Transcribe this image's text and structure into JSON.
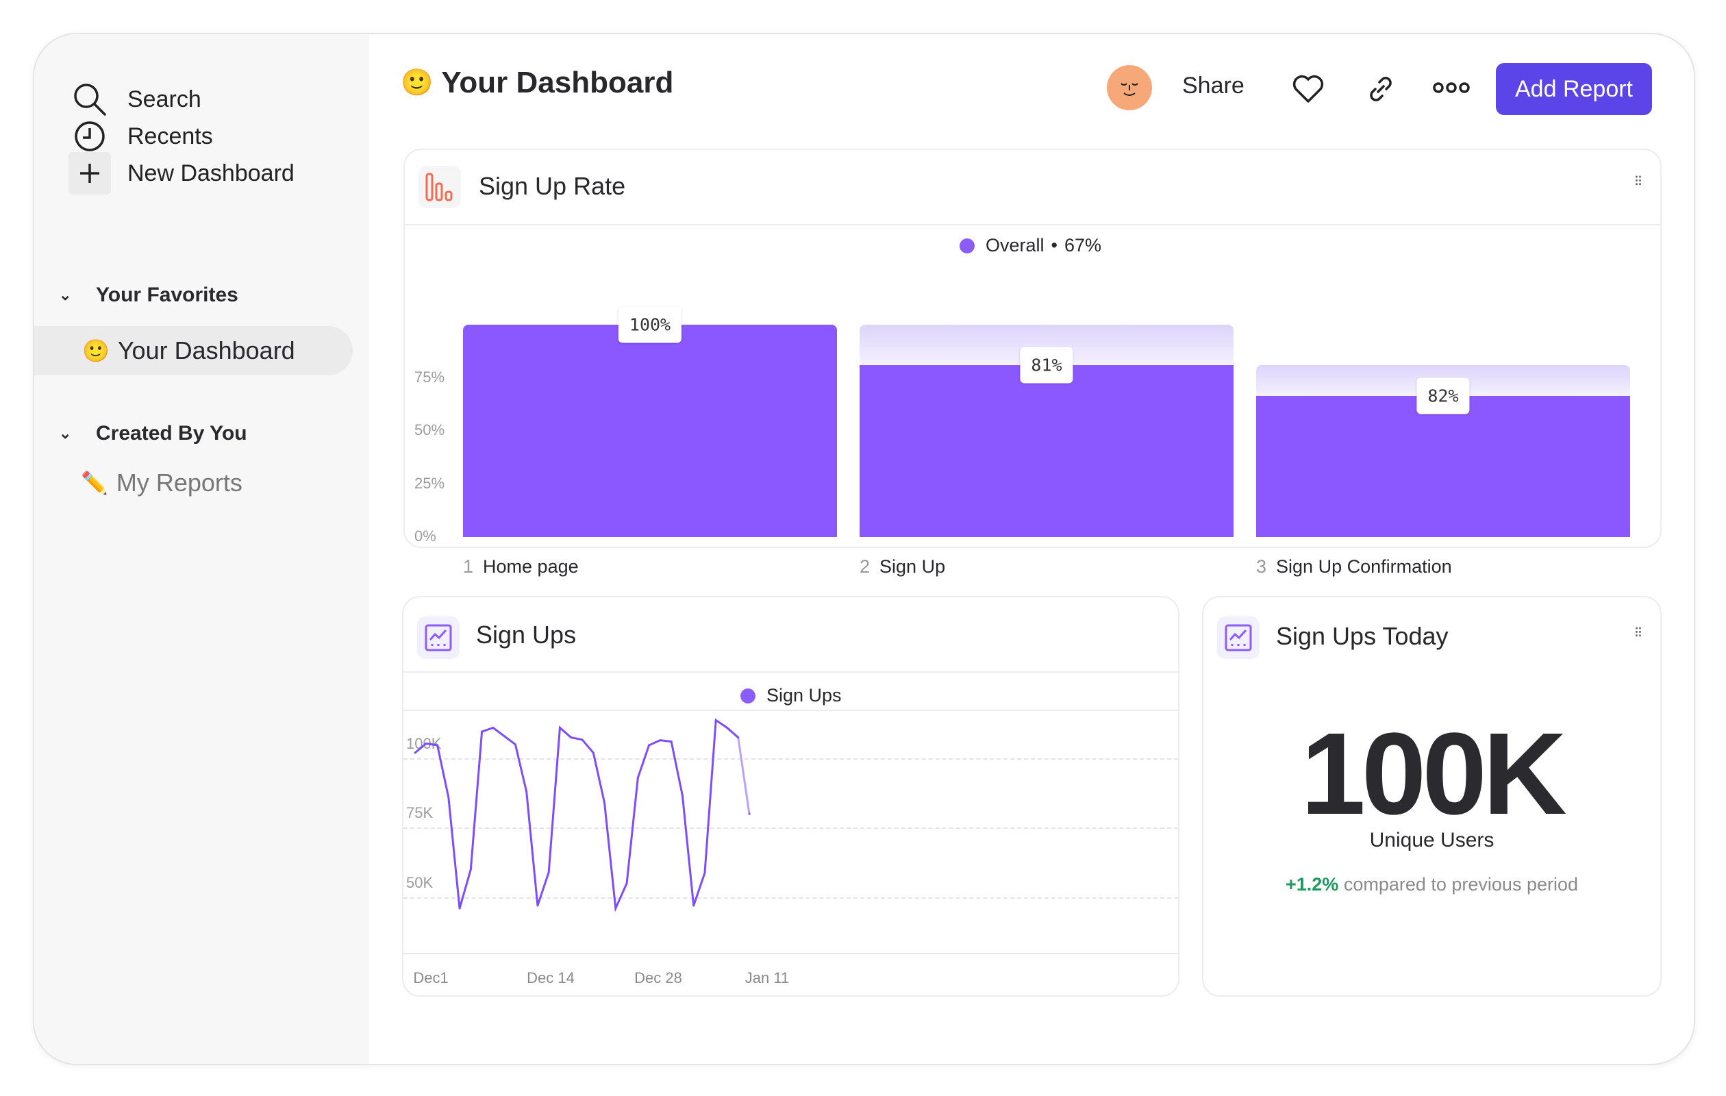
{
  "sidebar": {
    "search": "Search",
    "recents": "Recents",
    "new_dashboard": "New Dashboard",
    "favorites_header": "Your Favorites",
    "favorites": [
      {
        "emoji": "🙂",
        "label": "Your Dashboard"
      }
    ],
    "created_header": "Created By You",
    "created": [
      {
        "emoji": "✏️",
        "label": "My Reports"
      }
    ]
  },
  "header": {
    "emoji": "🙂",
    "title": "Your Dashboard",
    "share": "Share",
    "add_report": "Add Report",
    "accent": "#5b45e8"
  },
  "signup_rate": {
    "title": "Sign Up Rate",
    "legend": "Overall",
    "legend_value": "67%"
  },
  "signups": {
    "title": "Sign Ups",
    "legend": "Sign Ups"
  },
  "signups_today": {
    "title": "Sign Ups Today",
    "value": "100K",
    "label": "Unique Users",
    "change": "+1.2%",
    "change_text": "compared to previous period",
    "change_color": "#1a9a5c"
  },
  "chart_data": [
    {
      "type": "bar",
      "subtype": "funnel",
      "title": "Sign Up Rate",
      "categories": [
        "Home page",
        "Sign Up",
        "Sign Up Confirmation"
      ],
      "step_numbers": [
        "1",
        "2",
        "3"
      ],
      "values": [
        100,
        81,
        66.4
      ],
      "data_labels": [
        "100%",
        "81%",
        "82%"
      ],
      "yticks": [
        "0%",
        "25%",
        "50%",
        "75%"
      ],
      "ylim": [
        0,
        100
      ],
      "series": [
        {
          "name": "Overall",
          "values": [
            100,
            81,
            66.4
          ]
        }
      ],
      "color": "#8b57fe"
    },
    {
      "type": "line",
      "title": "Sign Ups",
      "series": [
        {
          "name": "Sign Ups",
          "values": [
            102000,
            105300,
            104700,
            86000,
            46000,
            60000,
            109600,
            111000,
            108000,
            105000,
            88000,
            47000,
            59000,
            111000,
            107500,
            106700,
            102000,
            84000,
            46000,
            55000,
            93000,
            104700,
            106500,
            106000,
            86600,
            47000,
            58700,
            113700,
            111000,
            107500,
            80000
          ]
        }
      ],
      "xticks": [
        "Dec1",
        "Dec 14",
        "Dec 28",
        "Jan 11"
      ],
      "yticks": [
        "50K",
        "75K",
        "100K"
      ],
      "ylim": [
        30000,
        117500
      ],
      "grid": true,
      "legend": "top",
      "color": "#7c4dff"
    }
  ]
}
